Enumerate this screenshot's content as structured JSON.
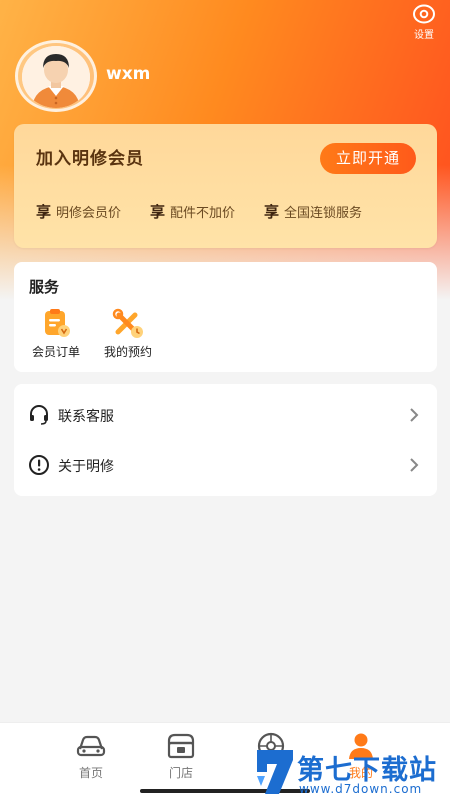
{
  "header": {
    "settings_label": "设置",
    "username": "wxm"
  },
  "vip": {
    "title": "加入明修会员",
    "button": "立即开通",
    "perks": [
      {
        "icon": "享",
        "label": "明修会员价"
      },
      {
        "icon": "享",
        "label": "配件不加价"
      },
      {
        "icon": "享",
        "label": "全国连锁服务"
      }
    ]
  },
  "services": {
    "title": "服务",
    "items": [
      {
        "label": "会员订单",
        "icon": "member-order-icon"
      },
      {
        "label": "我的预约",
        "icon": "appointment-icon"
      }
    ]
  },
  "menu": [
    {
      "label": "联系客服",
      "icon": "headset-icon"
    },
    {
      "label": "关于明修",
      "icon": "info-icon"
    }
  ],
  "tabbar": [
    {
      "label": "首页",
      "icon": "car-icon"
    },
    {
      "label": "门店",
      "icon": "store-icon"
    },
    {
      "label": "",
      "icon": "wheel-icon"
    },
    {
      "label": "我的",
      "icon": "profile-icon",
      "active": true
    }
  ],
  "watermark": {
    "title": "第七下载站",
    "url": "www.d7down.com"
  },
  "colors": {
    "accent": "#ff7a18",
    "vip_text": "#5a3410",
    "watermark": "#1c6dd0"
  }
}
